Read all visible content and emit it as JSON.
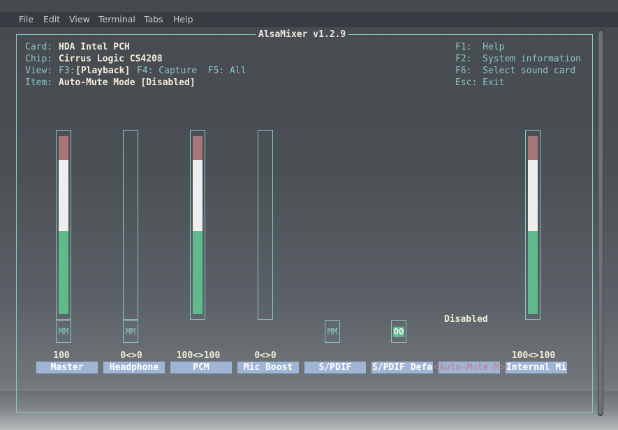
{
  "menu": [
    "File",
    "Edit",
    "View",
    "Terminal",
    "Tabs",
    "Help"
  ],
  "title": "AlsaMixer v1.2.9",
  "info": {
    "card_label": "Card:",
    "card_value": "HDA Intel PCH",
    "chip_label": "Chip:",
    "chip_value": "Cirrus Logic CS4208",
    "view_label": "View:",
    "view_f3": "F3:",
    "view_playback": "[Playback]",
    "view_rest": "F4: Capture  F5: All",
    "item_label": "Item:",
    "item_value": "Auto-Mute Mode [Disabled]"
  },
  "help": [
    "F1:  Help",
    "F2:  System information",
    "F6:  Select sound card",
    "Esc: Exit"
  ],
  "channels": [
    {
      "name": "Master",
      "volume_text": "100",
      "level": 100,
      "mute": "MM"
    },
    {
      "name": "Headphone",
      "volume_text": "0<>0",
      "level": 0,
      "mute": "MM"
    },
    {
      "name": "PCM",
      "volume_text": "100<>100",
      "level": 100,
      "mute": ""
    },
    {
      "name": "Mic Boost",
      "volume_text": "0<>0",
      "level": 0,
      "mute": ""
    },
    {
      "name": "S/PDIF",
      "volume_text": "",
      "mute": "MM"
    },
    {
      "name": "S/PDIF Defa",
      "volume_text": "",
      "mute": "OO"
    },
    {
      "name": "Auto-Mute M",
      "enum_value": "Disabled",
      "selected": true
    },
    {
      "name": "Internal Mi",
      "volume_text": "100<>100",
      "level": 100,
      "mute": ""
    }
  ],
  "arrow_left": "<",
  "arrow_right": ">",
  "colors": {
    "border": "#8cc6c3",
    "meter_red": "#a97677",
    "meter_white": "#eeeeee",
    "meter_green": "#5fbb8c",
    "channel_label_bg": "#9fb5d6",
    "selected_text": "#c47c82"
  }
}
